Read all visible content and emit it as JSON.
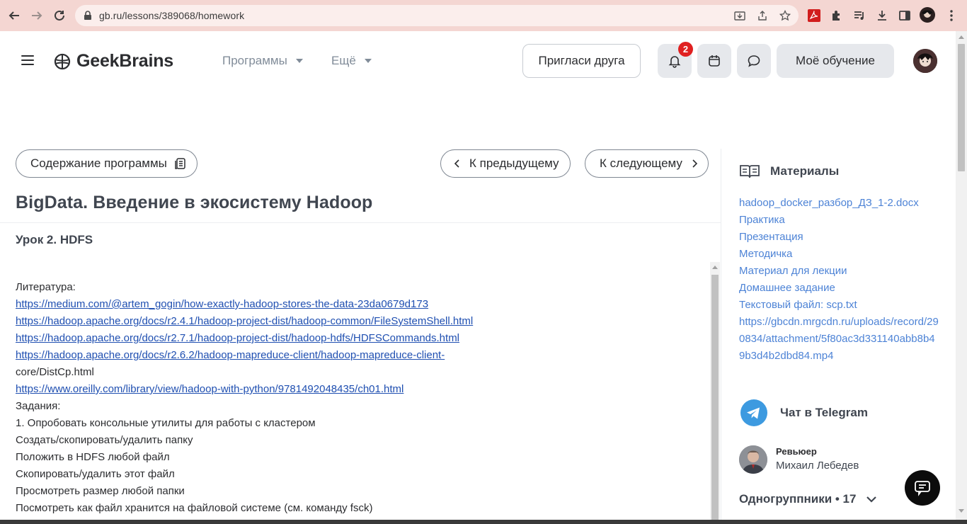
{
  "browser": {
    "url": "gb.ru/lessons/389068/homework"
  },
  "header": {
    "logo_text": "GeekBrains",
    "menu": [
      {
        "label": "Программы"
      },
      {
        "label": "Ещё"
      }
    ],
    "invite_label": "Пригласи друга",
    "notification_count": "2",
    "learning_label": "Моё обучение"
  },
  "nav": {
    "contents_label": "Содержание программы",
    "prev_label": "К предыдущему",
    "next_label": "К следующему"
  },
  "course_title": "BigData. Введение в экосистему Hadoop",
  "lesson_title": "Урок 2. HDFS",
  "body": {
    "literature_label": "Литература:",
    "links": [
      "https://medium.com/@artem_gogin/how-exactly-hadoop-stores-the-data-23da0679d173",
      "https://hadoop.apache.org/docs/r2.4.1/hadoop-project-dist/hadoop-common/FileSystemShell.html",
      "https://hadoop.apache.org/docs/r2.7.1/hadoop-project-dist/hadoop-hdfs/HDFSCommands.html",
      "https://hadoop.apache.org/docs/r2.6.2/hadoop-mapreduce-client/hadoop-mapreduce-client-"
    ],
    "link_continuation": "core/DistCp.html",
    "link5": "https://www.oreilly.com/library/view/hadoop-with-python/9781492048435/ch01.html",
    "tasks_label": "Задания:",
    "tasks": [
      "1. Опробовать консольные утилиты для работы с кластером",
      "Создать/скопировать/удалить папку",
      "Положить в HDFS любой файл",
      "Скопировать/удалить этот файл",
      "Просмотреть размер любой папки",
      "Посмотреть как файл хранится на файловой системе (см. команду fsck)"
    ]
  },
  "sidebar": {
    "materials_title": "Материалы",
    "materials": [
      "hadoop_docker_разбор_ДЗ_1-2.docx",
      "Практика",
      "Презентация",
      "Методичка",
      "Материал для лекции",
      "Домашнее задание",
      "Текстовый файл: scp.txt",
      "https://gbcdn.mrgcdn.ru/uploads/record/290834/attachment/5f80ac3d331140abb8b49b3d4b2dbd84.mp4"
    ],
    "telegram_label": "Чат в Telegram",
    "reviewer_label": "Ревьюер",
    "reviewer_name": "Михаил Лебедев",
    "groupmates_label": "Одногруппники • 17"
  }
}
